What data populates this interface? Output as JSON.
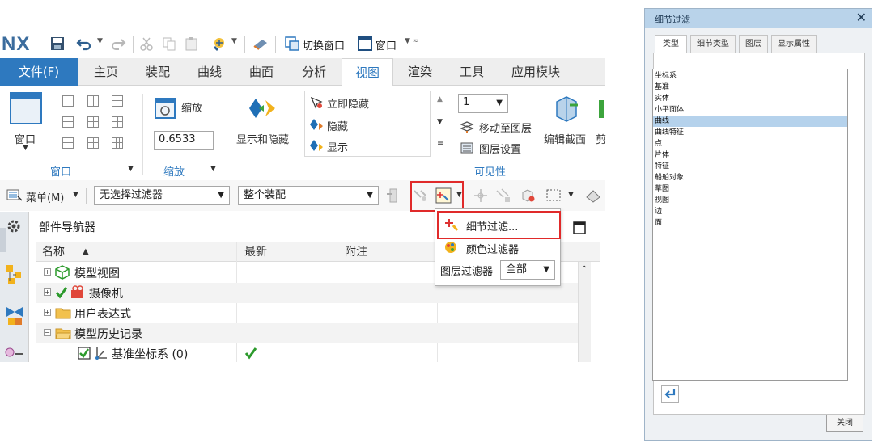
{
  "app": {
    "logo": "NX",
    "quick_access": {
      "switch_window": "切换窗口",
      "window": "窗口"
    }
  },
  "tabs": [
    "文件(F)",
    "主页",
    "装配",
    "曲线",
    "曲面",
    "分析",
    "视图",
    "渲染",
    "工具",
    "应用模块"
  ],
  "active_tab": "视图",
  "ribbon": {
    "window_group": {
      "button": "窗口",
      "label": "窗口"
    },
    "zoom_group": {
      "button": "缩放",
      "value": "0.6533",
      "label": "缩放"
    },
    "show_hide": "显示和隐藏",
    "immediate_hide": "立即隐藏",
    "hide": "隐藏",
    "show": "显示",
    "layer_value": "1",
    "move_to_layer": "移动至图层",
    "layer_settings": "图层设置",
    "visibility_label": "可见性",
    "edit_section": "编辑截面",
    "cut_partial": "剪"
  },
  "selbar": {
    "menu": "菜单(M)",
    "filter_value": "无选择过滤器",
    "scope_value": "整个装配"
  },
  "navigator": {
    "title": "部件导航器",
    "columns": {
      "name": "名称",
      "latest": "最新",
      "notes": "附注"
    },
    "rows": [
      {
        "label": "模型视图"
      },
      {
        "label": "摄像机"
      },
      {
        "label": "用户表达式"
      },
      {
        "label": "模型历史记录"
      },
      {
        "label": "基准坐标系 (0)"
      }
    ]
  },
  "dropdown_menu": {
    "item1": "细节过滤...",
    "item2": "颜色过滤器",
    "layer_filter_label": "图层过滤器",
    "layer_filter_value": "全部"
  },
  "dialog": {
    "title": "细节过滤",
    "tabs": [
      "类型",
      "细节类型",
      "图层",
      "显示属性"
    ],
    "active_tab": "类型",
    "items": [
      "坐标系",
      "基准",
      "实体",
      "小平面体",
      "曲线",
      "曲线特征",
      "点",
      "片体",
      "特征",
      "船舶对象",
      "草图",
      "视图",
      "边",
      "面"
    ],
    "selected_item": "曲线",
    "close": "关闭"
  },
  "colors": {
    "accent": "#2e79bf",
    "file_tab": "#2e79bf",
    "highlight": "#e02a2a",
    "dialog_title_bg": "#b9d3ea",
    "list_selection": "#b5d2ec",
    "check_green": "#2c9a2c"
  },
  "icons": [
    "save-icon",
    "undo-icon",
    "redo-icon",
    "cut-icon",
    "copy-icon",
    "paste-icon",
    "window-icon",
    "zoom-icon",
    "show-hide-icon",
    "move-layer-icon",
    "layer-settings-icon",
    "edit-section-icon",
    "filter-icon",
    "detail-filter-icon",
    "color-filter-icon",
    "settings-gear-icon",
    "model-view-icon",
    "camera-icon",
    "folder-icon",
    "datum-csys-icon",
    "checkmark-icon",
    "back-arrow-icon",
    "close-icon"
  ]
}
